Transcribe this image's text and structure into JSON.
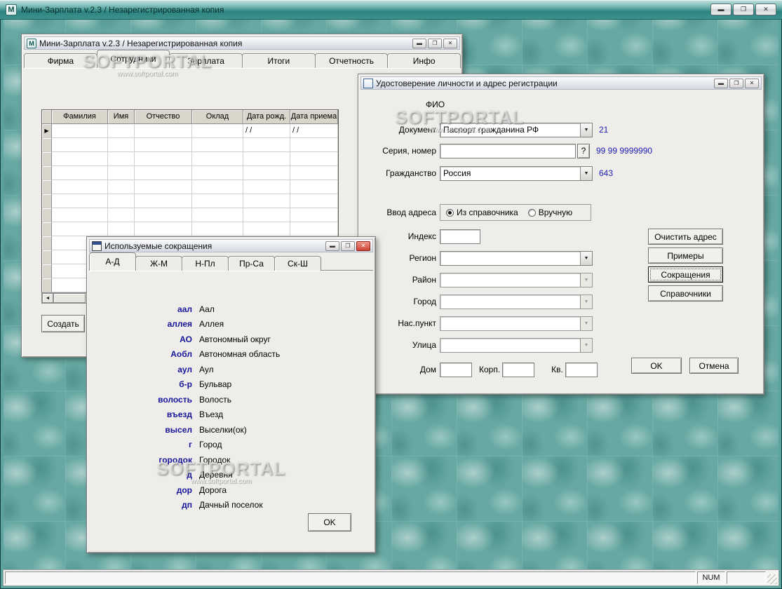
{
  "main_window": {
    "title": "Мини-Зарплата v.2.3 / Незарегистрированная копия",
    "icon_letter": "M",
    "status": {
      "num": "NUM"
    }
  },
  "watermark": {
    "brand": "SOFTPORTAL",
    "url": "www.softportal.com"
  },
  "employees_window": {
    "title": "Мини-Зарплата v.2.3 / Незарегистрированная копия",
    "tabs": [
      "Фирма",
      "Сотрудники",
      "Зарплата",
      "Итоги",
      "Отчетность",
      "Инфо"
    ],
    "active_tab": "Сотрудники",
    "table": {
      "columns": [
        "Фамилия",
        "Имя",
        "Отчество",
        "Оклад",
        "Дата рожд.",
        "Дата приема"
      ],
      "empty_rows": 12,
      "first_row": {
        "birth_date": "/ /",
        "hire_date": "/ /"
      }
    },
    "create_button": "Создать"
  },
  "identity_dialog": {
    "title": "Удостоверение личности и адрес регистрации",
    "fio_label": "ФИО",
    "document": {
      "label": "Документ",
      "value": "Паспорт гражданина РФ",
      "code": "21"
    },
    "series": {
      "label": "Серия, номер",
      "value": "",
      "help_button": "?",
      "code": "99 99 9999990"
    },
    "citizenship": {
      "label": "Гражданство",
      "value": "Россия",
      "code": "643"
    },
    "address_mode": {
      "label": "Ввод адреса",
      "option_directory": "Из справочника",
      "option_manual": "Вручную",
      "selected": "Из справочника"
    },
    "index": {
      "label": "Индекс",
      "value": ""
    },
    "region": {
      "label": "Регион",
      "value": ""
    },
    "district": {
      "label": "Район",
      "value": ""
    },
    "city": {
      "label": "Город",
      "value": ""
    },
    "settlement": {
      "label": "Нас.пункт",
      "value": ""
    },
    "street": {
      "label": "Улица",
      "value": ""
    },
    "house": {
      "label": "Дом",
      "value": ""
    },
    "building": {
      "label": "Корп.",
      "value": ""
    },
    "apartment": {
      "label": "Кв.",
      "value": ""
    },
    "buttons": {
      "clear_address": "Очистить адрес",
      "examples": "Примеры",
      "abbreviations": "Сокращения",
      "directories": "Справочники",
      "ok": "OK",
      "cancel": "Отмена"
    }
  },
  "abbreviations_dialog": {
    "title": "Используемые сокращения",
    "tabs": [
      "А-Д",
      "Ж-М",
      "Н-Пл",
      "Пр-Са",
      "Ск-Ш"
    ],
    "active_tab": "А-Д",
    "items": [
      {
        "abbr": "аал",
        "full": "Аал"
      },
      {
        "abbr": "аллея",
        "full": "Аллея"
      },
      {
        "abbr": "АО",
        "full": "Автономный округ"
      },
      {
        "abbr": "Аобл",
        "full": "Автономная область"
      },
      {
        "abbr": "аул",
        "full": "Аул"
      },
      {
        "abbr": "б-р",
        "full": "Бульвар"
      },
      {
        "abbr": "волость",
        "full": "Волость"
      },
      {
        "abbr": "въезд",
        "full": "Въезд"
      },
      {
        "abbr": "высел",
        "full": "Выселки(ок)"
      },
      {
        "abbr": "г",
        "full": "Город"
      },
      {
        "abbr": "городок",
        "full": "Городок"
      },
      {
        "abbr": "д",
        "full": "Деревня"
      },
      {
        "abbr": "дор",
        "full": "Дорога"
      },
      {
        "abbr": "дп",
        "full": "Дачный поселок"
      }
    ],
    "ok_button": "OK"
  }
}
